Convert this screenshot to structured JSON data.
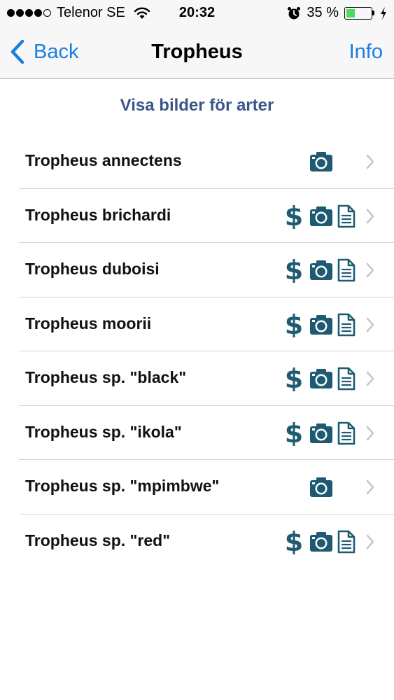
{
  "status_bar": {
    "carrier": "Telenor SE",
    "time": "20:32",
    "battery_percent": "35 %",
    "battery_level": 0.35,
    "signal_bars": 4,
    "battery_color": "#4cd964"
  },
  "nav": {
    "back_label": "Back",
    "title": "Tropheus",
    "info_label": "Info",
    "accent_color": "#1a7ee0"
  },
  "section_title": "Visa bilder för arter",
  "icon_color": "#1e5b72",
  "species": [
    {
      "name": "Tropheus annectens",
      "icons": [
        "camera-icon"
      ]
    },
    {
      "name": "Tropheus brichardi",
      "icons": [
        "dollar-icon",
        "camera-icon",
        "document-icon"
      ]
    },
    {
      "name": "Tropheus duboisi",
      "icons": [
        "dollar-icon",
        "camera-icon",
        "document-icon"
      ]
    },
    {
      "name": "Tropheus moorii",
      "icons": [
        "dollar-icon",
        "camera-icon",
        "document-icon"
      ]
    },
    {
      "name": "Tropheus sp. \"black\"",
      "icons": [
        "dollar-icon",
        "camera-icon",
        "document-icon"
      ]
    },
    {
      "name": "Tropheus sp. \"ikola\"",
      "icons": [
        "dollar-icon",
        "camera-icon",
        "document-icon"
      ]
    },
    {
      "name": "Tropheus sp. \"mpimbwe\"",
      "icons": [
        "camera-icon"
      ]
    },
    {
      "name": "Tropheus sp. \"red\"",
      "icons": [
        "dollar-icon",
        "camera-icon",
        "document-icon"
      ]
    }
  ]
}
